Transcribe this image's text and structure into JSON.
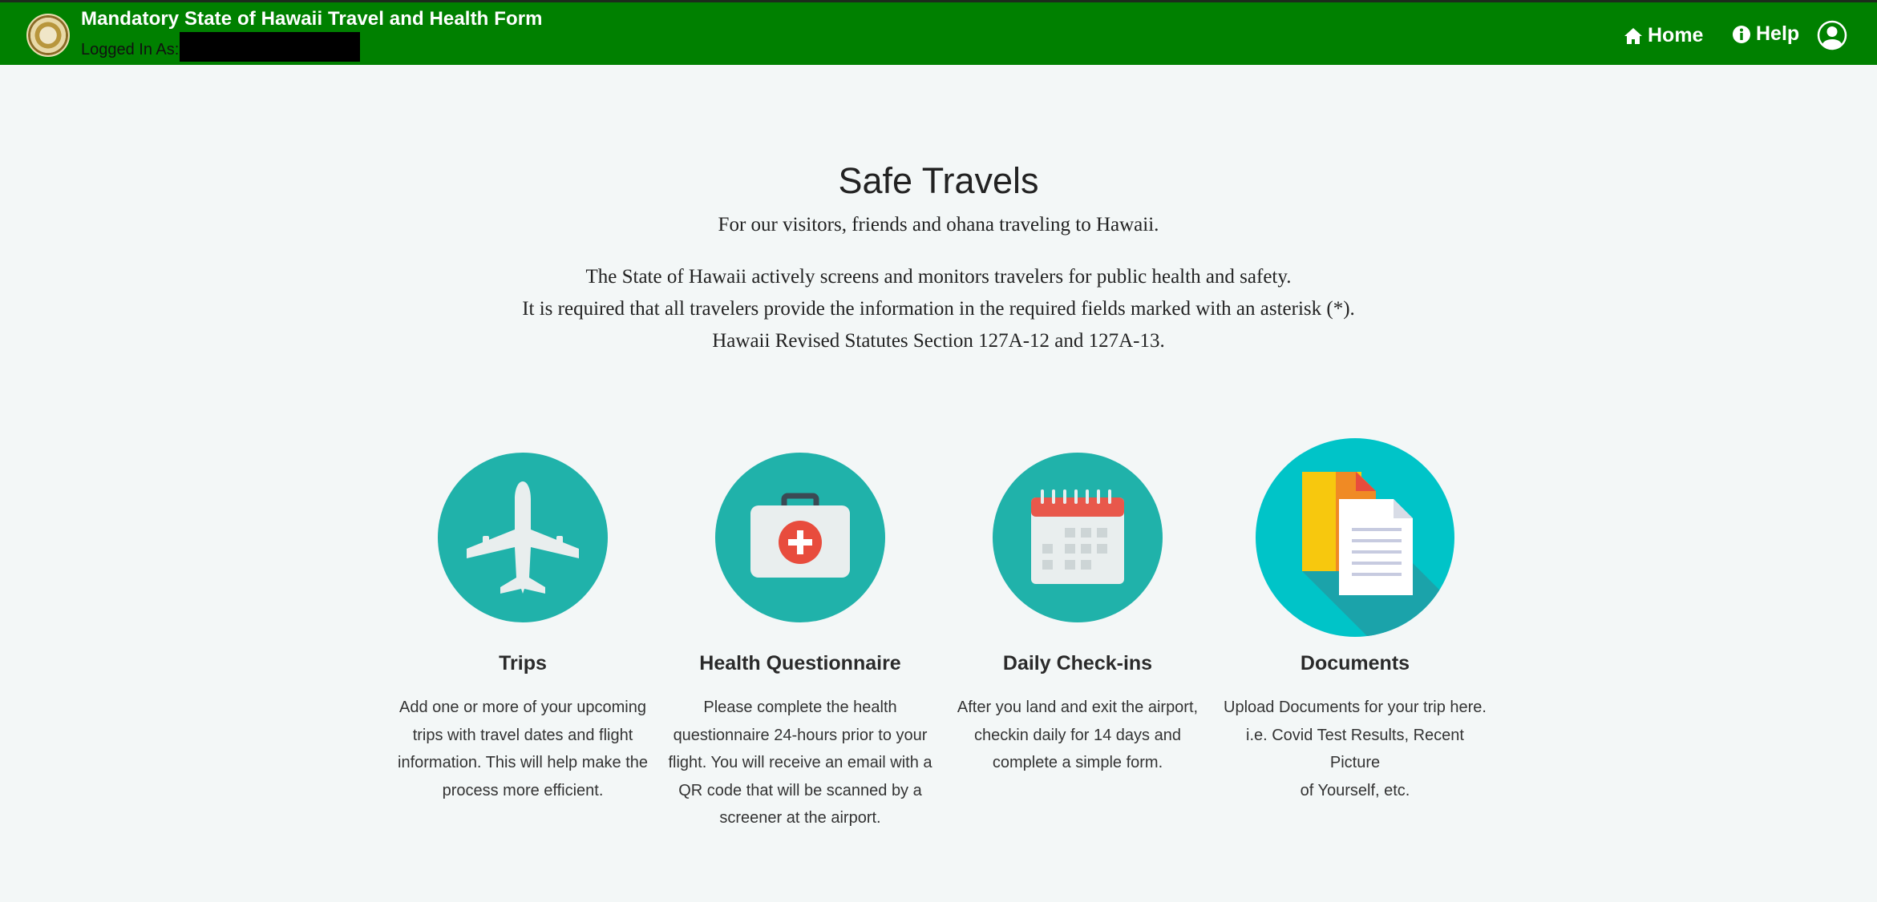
{
  "header": {
    "title": "Mandatory State of Hawaii Travel and Health Form",
    "logged_in_label": "Logged In As:",
    "nav": {
      "home_label": "Home",
      "help_label": "Help"
    },
    "icons": [
      "state-seal",
      "home-icon",
      "info-icon",
      "user-icon"
    ],
    "background_color": "#008000"
  },
  "hero": {
    "title": "Safe Travels",
    "subtitle": "For our visitors, friends and ohana traveling to Hawaii.",
    "lines": [
      "The State of Hawaii actively screens and monitors travelers for public health and safety.",
      "It is required that all travelers provide the information in the required fields marked with an asterisk (*).",
      "Hawaii Revised Statutes Section 127A-12 and 127A-13."
    ]
  },
  "cards": [
    {
      "title": "Trips",
      "icon": "airplane-icon",
      "description": [
        "Add one or more of your upcoming",
        "trips with travel dates and flight",
        "information. This will help make the",
        "process more efficient."
      ]
    },
    {
      "title": "Health Questionnaire",
      "icon": "first-aid-kit-icon",
      "description": [
        "Please complete the health",
        "questionnaire 24-hours prior to your",
        "flight. You will receive an email with a",
        "QR code that will be scanned by a",
        "screener at the airport."
      ]
    },
    {
      "title": "Daily Check-ins",
      "icon": "calendar-icon",
      "description": [
        "After you land and exit the airport,",
        "checkin daily for 14 days and",
        "complete a simple form."
      ]
    },
    {
      "title": "Documents",
      "icon": "documents-icon",
      "description": [
        "Upload Documents for your trip here.",
        "i.e. Covid Test Results, Recent Picture",
        "of Yourself, etc."
      ]
    }
  ],
  "colors": {
    "teal": "#20b2aa",
    "cyan": "#00c4c8",
    "page_background": "#f3f7f7"
  }
}
